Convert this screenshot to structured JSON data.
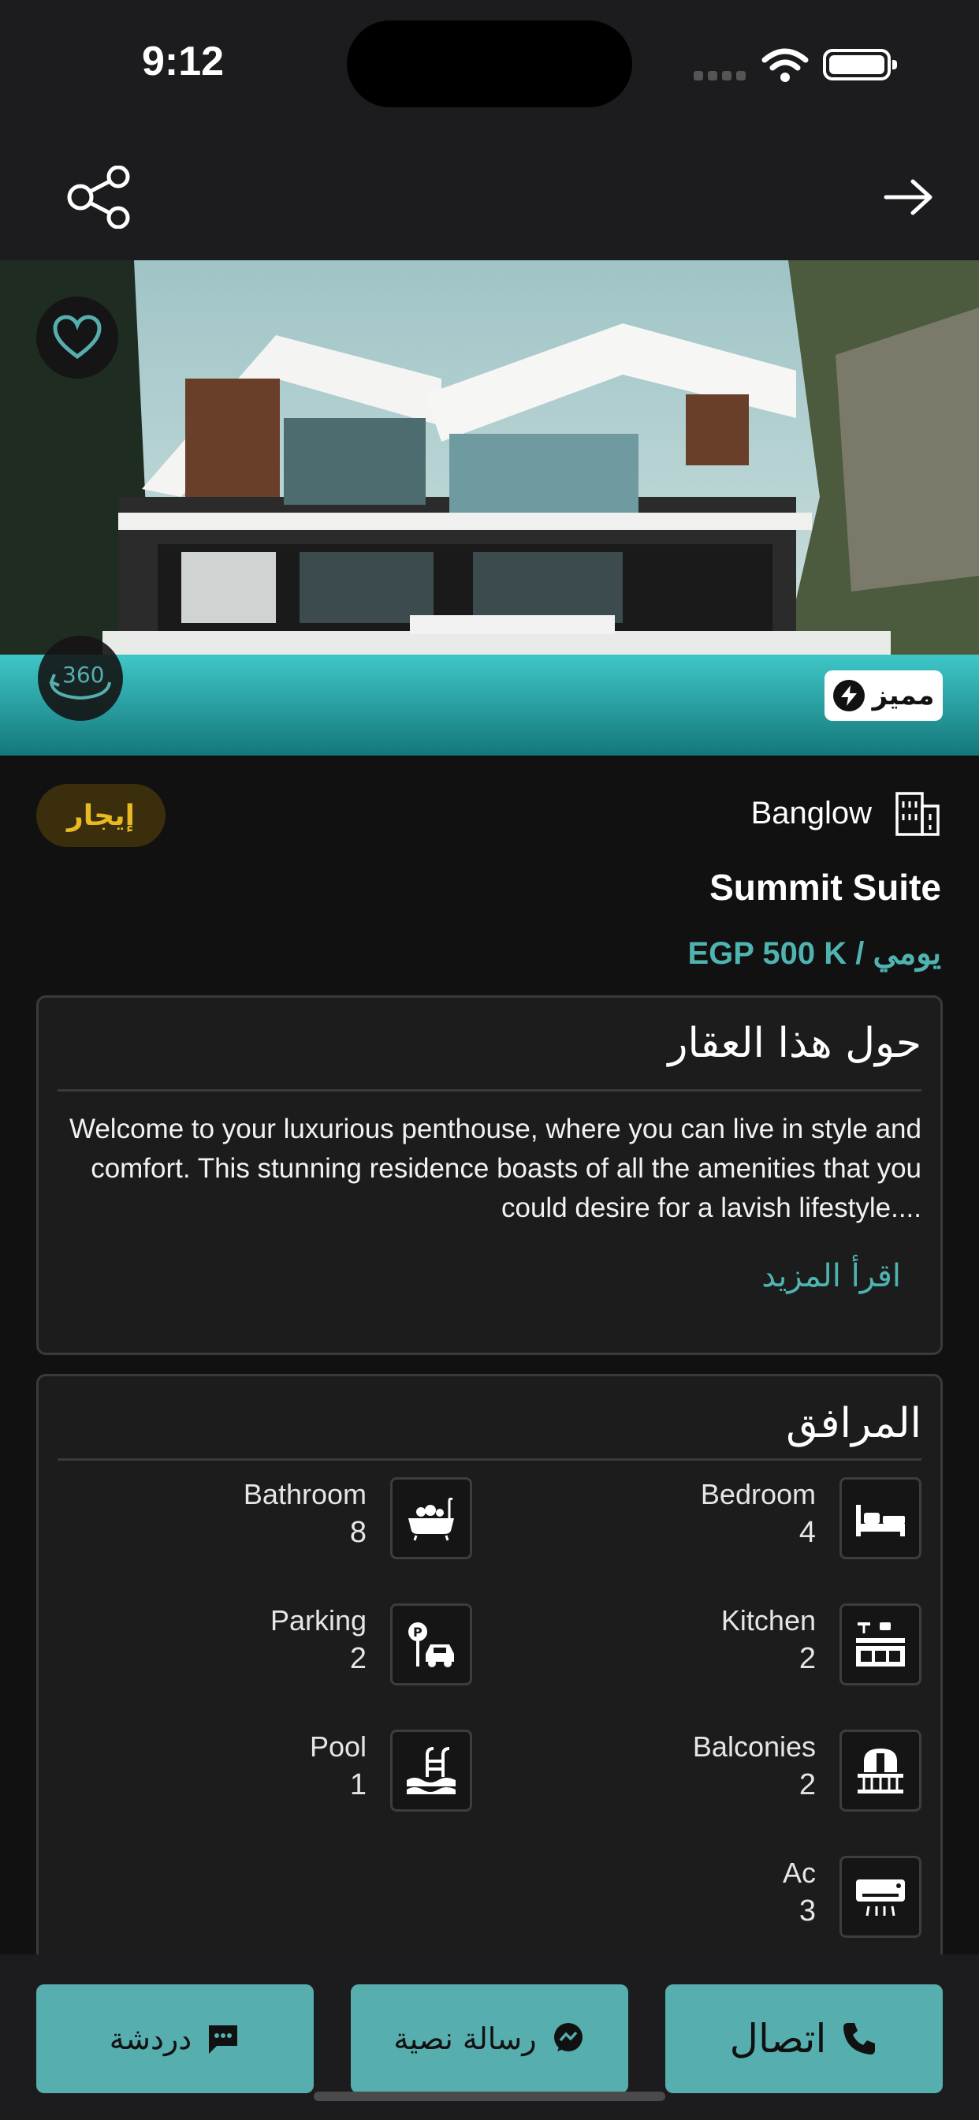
{
  "status_bar": {
    "time": "9:12"
  },
  "nav": {
    "share_icon": "share-icon",
    "back_icon": "arrow-right-icon"
  },
  "hero": {
    "favorite_icon": "heart-icon",
    "tour_icon": "360-view-icon",
    "featured_label": "مميز"
  },
  "listing": {
    "offer_type": "إيجار",
    "property_type": "Banglow",
    "title": "Summit Suite",
    "price": "EGP 500 K / يومي"
  },
  "about": {
    "title": "حول هذا العقار",
    "description": "Welcome to your luxurious penthouse, where you can live in style and comfort. This stunning residence boasts of all the amenities that you could desire for a lavish lifestyle....",
    "read_more": "اقرأ المزيد"
  },
  "amenities": {
    "title": "المرافق",
    "items": [
      {
        "name": "Bedroom",
        "count": "4",
        "icon": "bed-icon"
      },
      {
        "name": "Bathroom",
        "count": "8",
        "icon": "bathtub-icon"
      },
      {
        "name": "Kitchen",
        "count": "2",
        "icon": "kitchen-icon"
      },
      {
        "name": "Parking",
        "count": "2",
        "icon": "parking-icon"
      },
      {
        "name": "Balconies",
        "count": "2",
        "icon": "balcony-icon"
      },
      {
        "name": "Pool",
        "count": "1",
        "icon": "pool-icon"
      },
      {
        "name": "Ac",
        "count": "3",
        "icon": "air-conditioner-icon"
      }
    ]
  },
  "actions": {
    "chat_label": "دردشة",
    "sms_label": "رسالة نصية",
    "call_label": "اتصال"
  },
  "colors": {
    "accent": "#56aeae",
    "price": "#4fb3b0",
    "pill_text": "#e8b923",
    "pill_bg": "#3b2e0c"
  }
}
